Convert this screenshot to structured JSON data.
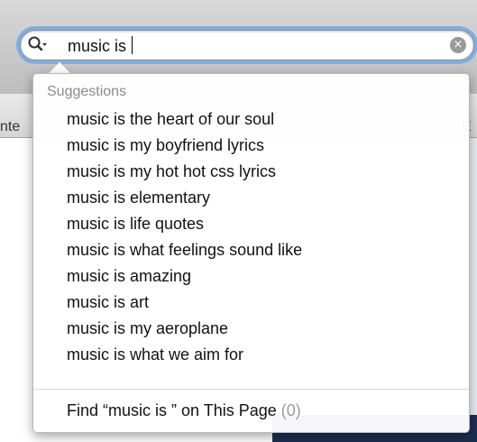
{
  "search": {
    "value": "music is "
  },
  "bookmarks": {
    "left_text": "nte",
    "right_text": "E"
  },
  "dropdown": {
    "section_title": "Suggestions",
    "suggestions": [
      "music is the heart of our soul",
      "music is my boyfriend lyrics",
      "music is my hot hot css lyrics",
      "music is elementary",
      "music is life quotes",
      "music is what feelings sound like",
      "music is amazing",
      "music is art",
      "music is my aeroplane",
      "music is what we aim for"
    ],
    "find_label": "Find “music is ” on This Page",
    "find_count": "(0)"
  },
  "colors": {
    "focus_ring": "#7eaee0",
    "suggestion_text": "#111111",
    "header_text": "#8b8b8b"
  },
  "icons": {
    "search": "search-icon",
    "clear": "clear-icon"
  }
}
